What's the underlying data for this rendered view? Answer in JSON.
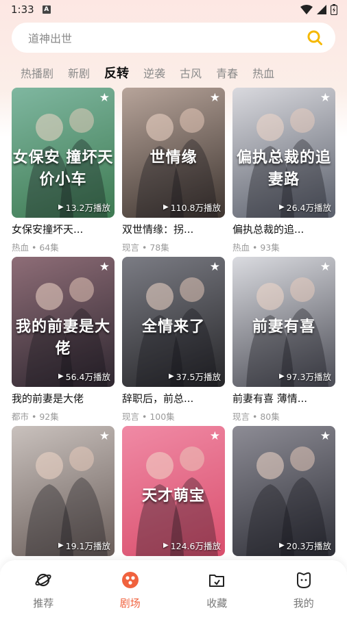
{
  "status": {
    "time": "1:33",
    "notif": "A"
  },
  "search": {
    "placeholder": "道神出世"
  },
  "tabs": [
    {
      "label": "热播剧",
      "active": false
    },
    {
      "label": "新剧",
      "active": false
    },
    {
      "label": "反转",
      "active": true
    },
    {
      "label": "逆袭",
      "active": false
    },
    {
      "label": "古风",
      "active": false
    },
    {
      "label": "青春",
      "active": false
    },
    {
      "label": "热血",
      "active": false
    }
  ],
  "cards": [
    {
      "title": "女保安撞坏天...",
      "meta": "热血 • 64集",
      "plays": "13.2万播放",
      "poster_text": "女保安 撞坏天价小车",
      "colors": [
        "#7fb7a0",
        "#3e7a52"
      ]
    },
    {
      "title": "双世情缘：拐...",
      "meta": "现言 • 78集",
      "plays": "110.8万播放",
      "poster_text": "世情缘",
      "colors": [
        "#b7a49a",
        "#3e3530"
      ]
    },
    {
      "title": "偏执总裁的追...",
      "meta": "热血 • 93集",
      "plays": "26.4万播放",
      "poster_text": "偏执总裁的追妻路",
      "colors": [
        "#d9d9de",
        "#5a5f6b"
      ]
    },
    {
      "title": "我的前妻是大佬",
      "meta": "都市 • 92集",
      "plays": "56.4万播放",
      "poster_text": "我的前妻是大佬",
      "colors": [
        "#8e6d77",
        "#2f2730"
      ]
    },
    {
      "title": "辞职后，前总...",
      "meta": "现言 • 100集",
      "plays": "37.5万播放",
      "poster_text": "全情来了",
      "colors": [
        "#7b7c84",
        "#262629"
      ]
    },
    {
      "title": "前妻有喜 薄情...",
      "meta": "现言 • 80集",
      "plays": "97.3万播放",
      "poster_text": "前妻有喜",
      "colors": [
        "#dadbe0",
        "#4b4c55"
      ]
    },
    {
      "title": "",
      "meta": "",
      "plays": "19.1万播放",
      "poster_text": "",
      "colors": [
        "#c9c1bd",
        "#6a5e5a"
      ]
    },
    {
      "title": "",
      "meta": "",
      "plays": "124.6万播放",
      "poster_text": "天才萌宝",
      "colors": [
        "#f08aa5",
        "#d94f6d"
      ]
    },
    {
      "title": "",
      "meta": "",
      "plays": "20.3万播放",
      "poster_text": "",
      "colors": [
        "#8d8c95",
        "#2f3038"
      ]
    }
  ],
  "nav": [
    {
      "label": "推荐",
      "icon": "planet-icon",
      "active": false
    },
    {
      "label": "剧场",
      "icon": "theater-icon",
      "active": true
    },
    {
      "label": "收藏",
      "icon": "folder-icon",
      "active": false
    },
    {
      "label": "我的",
      "icon": "face-icon",
      "active": false
    }
  ],
  "accent": "#f0623e",
  "search_icon_color": "#f5b800"
}
